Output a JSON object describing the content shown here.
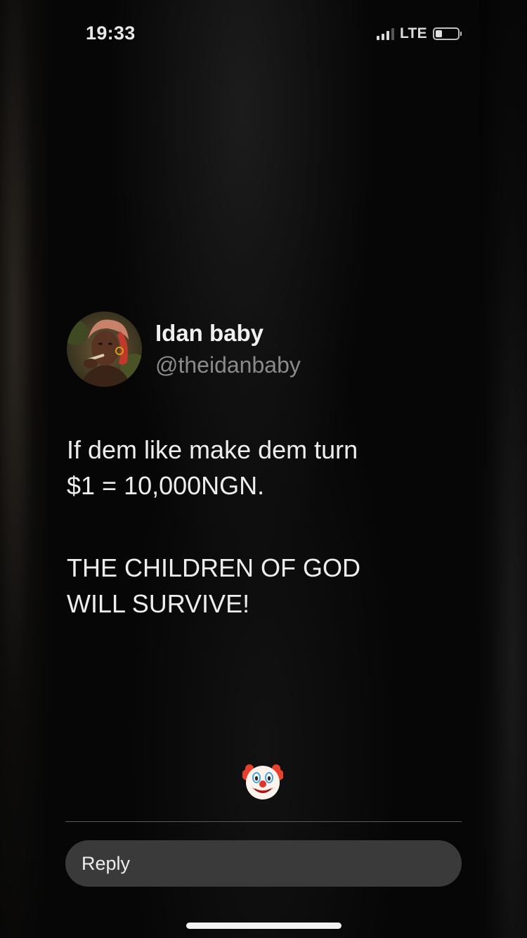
{
  "status_bar": {
    "time": "19:33",
    "network": "LTE",
    "signal_bars": 3,
    "battery_level": 0.3
  },
  "tweet": {
    "display_name": "Idan baby",
    "handle": "@theidanbaby",
    "lines": [
      "If dem like make dem turn",
      "$1 = 10,000NGN.",
      "THE CHILDREN OF GOD",
      "WILL SURVIVE!"
    ]
  },
  "reaction": {
    "emoji": "clown-face"
  },
  "reply": {
    "placeholder": "Reply"
  },
  "colors": {
    "background": "#000000",
    "text_primary": "#ededed",
    "text_secondary": "#8a8a8a",
    "reply_bg": "#3a3a3a"
  }
}
